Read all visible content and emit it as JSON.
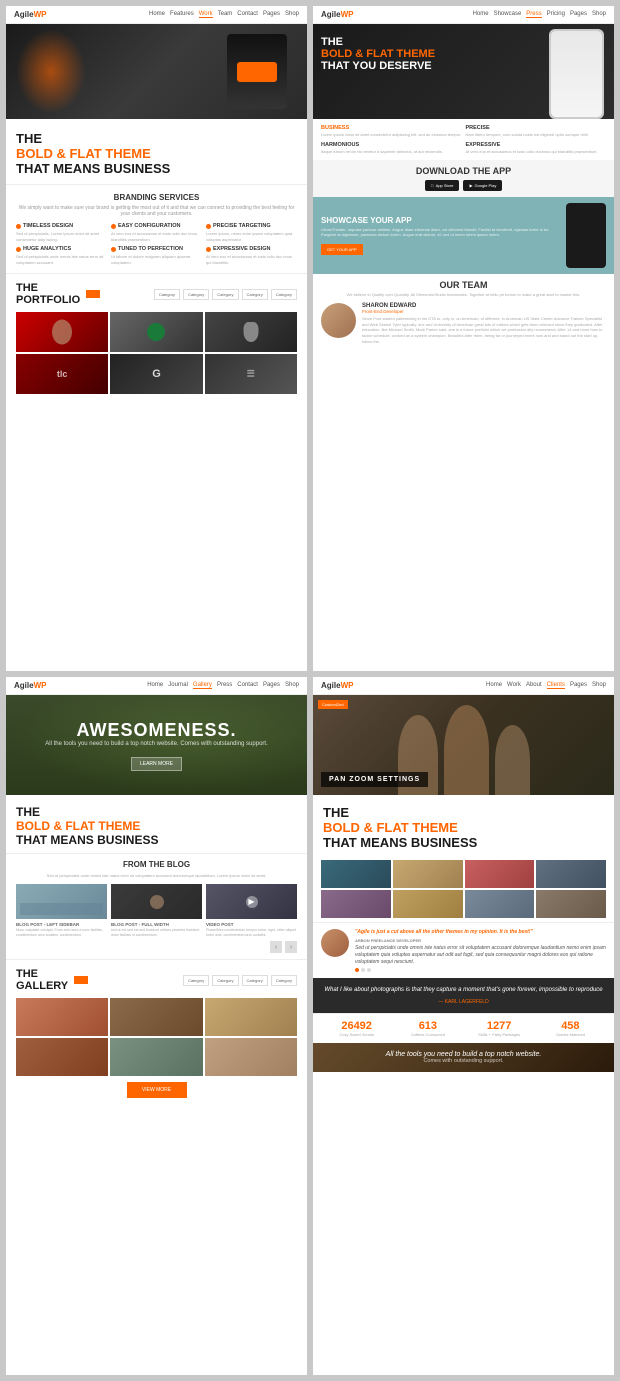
{
  "panels": {
    "p1": {
      "nav": {
        "logo": "Agile",
        "logo_accent": "WP",
        "items": [
          "Home",
          "Features",
          "Work",
          "Team",
          "Contact",
          "Pages",
          "Shop"
        ]
      },
      "headline": {
        "line1": "THE",
        "line2": "BOLD & FLAT THEME",
        "line3": "THAT MEANS BUSINESS"
      },
      "branding": {
        "title": "BRANDING SERVICES",
        "subtitle": "We simply want to make sure your brand is getting the most out of it and that we can connect to providing the best feeling for your clients and your customers.",
        "features": [
          {
            "dot_color": "orange",
            "title": "TIMELESS DESIGN",
            "text": "Sed ut perspiciatis, Lorem ipsum dolor sit amet consectetur adip iscing."
          },
          {
            "dot_color": "orange",
            "title": "EASY CONFIGURATION",
            "text": "At vero eos et accusamus et iusto odio duc imus, blanditiis praesentium."
          },
          {
            "dot_color": "orange",
            "title": "PRECISE TARGETING",
            "text": "Lorem ipsum, nemo enim ipsam voluptatem quia voluptas aspernatur."
          },
          {
            "dot_color": "orange",
            "title": "HUGE ANALYTICS",
            "text": "Sed ut perspiciatis unde omnis iste natus error sit voluptatem accusant."
          },
          {
            "dot_color": "orange",
            "title": "TUNED TO PERFECTION",
            "text": "Ut labore et dolore magnam aliquam quaerat voluptatem."
          },
          {
            "dot_color": "orange",
            "title": "EXPRESSIVE DESIGN",
            "text": "At vero eos et accusamus et iusto odio duc imus qui blanditiis."
          }
        ]
      },
      "portfolio": {
        "title": "THE\nPORTFOLIO",
        "filters": [
          "Category",
          "Category",
          "Category",
          "Category",
          "Category"
        ],
        "images": [
          {
            "class": "img1",
            "label": "face"
          },
          {
            "class": "img2",
            "label": "coffee"
          },
          {
            "class": "img3",
            "label": "dark"
          },
          {
            "class": "img4",
            "label": "red"
          },
          {
            "class": "img5",
            "label": "text"
          },
          {
            "class": "img6",
            "label": "dark2"
          }
        ]
      }
    },
    "p2": {
      "nav": {
        "logo": "Agile",
        "logo_accent": "WP",
        "items": [
          "Home",
          "Showcase",
          "Press",
          "Pricing",
          "Pages",
          "Shop"
        ]
      },
      "hero": {
        "line1": "THE",
        "line2": "BOLD & FLAT THEME",
        "line3": "THAT YOU DESERVE"
      },
      "app_features": [
        {
          "title": "BUSINESS",
          "is_orange": true,
          "text": "Lorem ipsum dolor sit amet consectetur adipiscing elit, sed do eiusmod tempor."
        },
        {
          "title": "PRECISE",
          "is_orange": false,
          "text": "Nam libero tempore, cum soluta nobis est eligendi optio cumque nihil."
        },
        {
          "title": "HARMONIOUS",
          "is_orange": false,
          "text": "Itaque earum rerum hic tenetur a sapiente delectus, ut aut reiciendis."
        },
        {
          "title": "EXPRESSIVE",
          "is_orange": false,
          "text": "At vero eos et accusamus et iusto odio ducimus qui blanditiis praesentium."
        }
      ],
      "download": {
        "title": "DOWNLOAD THE APP",
        "apple": "App Store",
        "google": "Google Play"
      },
      "showcase": {
        "title": "SHOWCASE YOUR APP",
        "text": "UrbanTheater, Impulse parkour athletic, Augue diam eliermae diam, vut dictumst blandit. Facilisi at hendrerit, egestas tortor in tur. Pargene at dignissim, paraurna dictum lorem. Augue erat dictum, 40 orci ut lorem lorem ipsum lorem.",
        "btn": "GET YOUR APP"
      },
      "team": {
        "title": "OUR TEAM",
        "subtitle": "We believe in Quality over Quantity. All ElementorStudio teammates, Together at hello pe torium to make a great start to master this.",
        "member": {
          "name": "SHARON EDWARD",
          "role": "Front-End Developer",
          "bio": "Since Ford started patternizing in his GTA to, only in, on American, of different, in American US State Center Advance Trainee Specialist and Web Sketch Tyler typically, she and University of American great lots of editors which gets them relevant since they graduated. After education, like Michael Smith, Mark Parker said, she is a future portfolio which we profession ally recommend, After 14 and more how to tackle schedule, worked as a system champion. Beautiful after them, being far or journeyed event now and and stand out the start up, follow the."
        }
      }
    },
    "p3": {
      "nav": {
        "logo": "Agile",
        "logo_accent": "WP",
        "items": [
          "Home",
          "Journal",
          "Gallery",
          "Press",
          "Contact",
          "Pages",
          "Shop"
        ]
      },
      "hero": {
        "title": "AWESOMENESS.",
        "subtitle": "All the tools you need to build a top notch website. Comes with outstanding support.",
        "btn": "LEARN MORE"
      },
      "headline": {
        "line1": "THE",
        "line2": "BOLD & FLAT THEME",
        "line3": "THAT MEANS BUSINESS"
      },
      "blog": {
        "title": "FROM THE BLOG",
        "subtitle": "Sed ut perspiciatis unde omnis iste natus error sit voluptatem accusant doloremque laudantium, Lorem ipsum dolor sit amet.",
        "posts": [
          {
            "title": "BLOG POST - LEFT SIDEBAR",
            "img_class": "b1",
            "text": "Nunc vulputate volutpat. From and need a nunc facilisis, condimentum arcu sodales, condimentum."
          },
          {
            "title": "BLOG POST - FULL WIDTH",
            "img_class": "b2",
            "text": "sed ut est sed est sed tincidunt ultrices pharetra tincidunt. dolor facilisis in condimentum."
          },
          {
            "title": "VIDEO POST",
            "img_class": "b3",
            "text": "PhasellVes condimentum tempor tortor. eget, other aliquet tortor duis. condimentum arcu sodales."
          }
        ]
      },
      "gallery": {
        "title": "THE\nGALLERY",
        "filters": [
          "Category",
          "Category",
          "Category",
          "Category"
        ],
        "images": [
          {
            "class": "g1"
          },
          {
            "class": "g2"
          },
          {
            "class": "g3"
          },
          {
            "class": "g4"
          },
          {
            "class": "g5"
          },
          {
            "class": "g6"
          }
        ],
        "view_more": "VIEW MORE"
      }
    },
    "p4": {
      "nav": {
        "logo": "Agile",
        "logo_accent": "WP",
        "items": [
          "Home",
          "Work",
          "About",
          "Clients",
          "Pages",
          "Shop"
        ]
      },
      "hero": {
        "custom_label": "CustomiZed",
        "panzoom": "PAN ZOOM SETTINGS"
      },
      "headline": {
        "line1": "THE",
        "line2": "BOLD & FLAT THEME",
        "line3": "THAT MEANS BUSINESS"
      },
      "testimonial": {
        "quote": "\"Agile is just a cut above all the other themes in my opinion. It is the best!\"",
        "name": "ARBON FREELANCE DEVELOPER",
        "text": "Sed ut perspiciatis unde omnis iste natus error sit voluptatem accusant doloremque laudantium nemo enim ipsam voluptatem quia voluptas aspernatur aut odit aut fugit, sed quia consequuntur magni dolores eos qui ratione voluptatem sequi nesciunt."
      },
      "quote": {
        "text": "What I like about photographs is that they capture a moment that's gone forever, impossible to reproduce",
        "author": "— KARL LAGERFELD"
      },
      "stats": [
        {
          "num": "26492",
          "label": "Cozy Sweet Scrolls"
        },
        {
          "num": "613",
          "label": "Coffees Consumed"
        },
        {
          "num": "1277",
          "label": "Skills + Party Packages"
        },
        {
          "num": "458",
          "label": "Guests Matched"
        }
      ],
      "footer": {
        "text": "All the tools you need to build a top notch website.",
        "sub": "Comes with outstanding support."
      }
    }
  }
}
